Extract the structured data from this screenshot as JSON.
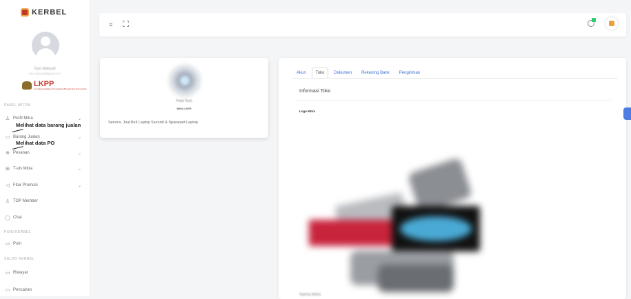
{
  "brand": {
    "name": "KERBEL"
  },
  "sidebar": {
    "user_name": "Toyo Wahyudi",
    "user_email": "toyo.wahyudi@gmail.com",
    "org_logo_text": "LKPP",
    "org_logo_sub": "Lembaga Kebijakan Pengadaan Barang/Jasa Pemerintah",
    "sections": [
      "PANEL MITRA",
      "POIN KERBEL",
      "SALDO KERBEL"
    ],
    "items": [
      {
        "label": "Profil Mitra",
        "icon": "user-icon",
        "has_chevron": true
      },
      {
        "label": "Barang Jualan",
        "icon": "box-icon",
        "has_chevron": true
      },
      {
        "label": "Pesanan",
        "icon": "package-icon",
        "has_chevron": true
      },
      {
        "label": "T-uls Mitra",
        "icon": "grid-icon",
        "has_chevron": true
      },
      {
        "label": "Fitur Promosi",
        "icon": "megaphone-icon",
        "has_chevron": true
      },
      {
        "label": "TOP Member",
        "icon": "users-icon",
        "has_chevron": false
      },
      {
        "label": "Chat",
        "icon": "chat-icon",
        "has_chevron": false
      },
      {
        "label": "Poin",
        "icon": "card-icon",
        "has_chevron": false
      },
      {
        "label": "Riwayat",
        "icon": "card-icon",
        "has_chevron": false
      },
      {
        "label": "Pencairan",
        "icon": "card-icon",
        "has_chevron": false
      }
    ],
    "glyphs": {
      "user": "♙",
      "box": "▭",
      "package": "⊕",
      "grid": "⊞",
      "megaphone": "◁",
      "users": "♙",
      "chat": "◯",
      "card": "▭",
      "chevron": "⌄"
    }
  },
  "annotations": [
    {
      "text": "Melihat data barang jualan"
    },
    {
      "text": "Melihat data PO"
    }
  ],
  "topbar": {
    "menu_glyph": "≡"
  },
  "shop": {
    "name": "Point Tech",
    "badge": "Mitra LKPP",
    "description": "Service, Jual Beli Laptop Second & Sparepart Laptop"
  },
  "tabs": [
    {
      "label": "Akun",
      "active": false
    },
    {
      "label": "Toko",
      "active": true
    },
    {
      "label": "Dokumen",
      "active": false
    },
    {
      "label": "Rekening Bank",
      "active": false
    },
    {
      "label": "Pengiriman",
      "active": false
    }
  ],
  "store_info": {
    "title": "Informasi Toko",
    "logo_label": "Logo Mitra",
    "next_label": "Nama Mitra"
  },
  "colors": {
    "accent": "#3b6fd1",
    "badge_green": "#2ecc71",
    "brand_red": "#c0392b",
    "brand_orange": "#e9a23b"
  }
}
